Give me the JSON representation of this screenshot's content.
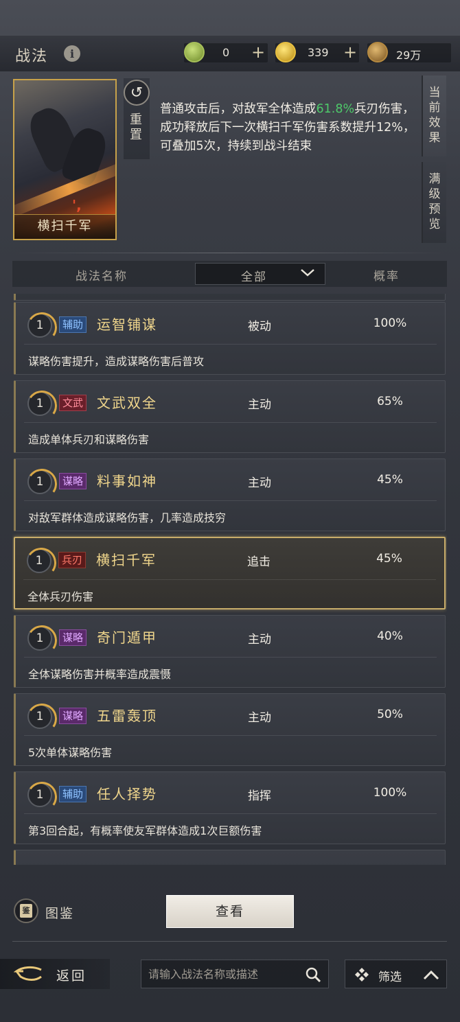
{
  "header": {
    "title": "战法",
    "info_icon": "i",
    "resources": [
      {
        "name": "jade-coin",
        "value": "0",
        "color": "#8fae4a"
      },
      {
        "name": "gold-coin",
        "value": "339",
        "color": "#d9b42a"
      },
      {
        "name": "copper-coin",
        "value": "29万",
        "color": "#a8803a"
      }
    ],
    "plus": "+"
  },
  "skill_card": {
    "name": "横扫千军",
    "mark": "',"
  },
  "reset": {
    "icon": "↺",
    "label": "重置"
  },
  "description": {
    "before": "普通攻击后，对敌军全体造成",
    "highlight": "61.8%",
    "after": "兵刃伤害，成功释放后下一次横扫千军伤害系数提升12%，可叠加5次，持续到战斗结束",
    "highlight_color": "#4ec96a"
  },
  "side_tabs": [
    {
      "label": "当前效果",
      "active": true
    },
    {
      "label": "满级预览",
      "active": false
    }
  ],
  "table_header": {
    "name_col": "战法名称",
    "filter_value": "全部",
    "rate_col": "概率"
  },
  "skills": [
    {
      "level": "1",
      "tag": "辅助",
      "tag_class": "fuzhu",
      "name": "运智铺谋",
      "type": "被动",
      "rate": "100%",
      "desc": "谋略伤害提升，造成谋略伤害后普攻",
      "selected": false
    },
    {
      "level": "1",
      "tag": "文武",
      "tag_class": "wenwu",
      "name": "文武双全",
      "type": "主动",
      "rate": "65%",
      "desc": "造成单体兵刃和谋略伤害",
      "selected": false
    },
    {
      "level": "1",
      "tag": "谋略",
      "tag_class": "moulue",
      "name": "料事如神",
      "type": "主动",
      "rate": "45%",
      "desc": "对敌军群体造成谋略伤害，几率造成技穷",
      "selected": false
    },
    {
      "level": "1",
      "tag": "兵刃",
      "tag_class": "bingren",
      "name": "横扫千军",
      "type": "追击",
      "rate": "45%",
      "desc": "全体兵刃伤害",
      "selected": true
    },
    {
      "level": "1",
      "tag": "谋略",
      "tag_class": "moulue",
      "name": "奇门遁甲",
      "type": "主动",
      "rate": "40%",
      "desc": "全体谋略伤害并概率造成震慑",
      "selected": false
    },
    {
      "level": "1",
      "tag": "谋略",
      "tag_class": "moulue",
      "name": "五雷轰顶",
      "type": "主动",
      "rate": "50%",
      "desc": "5次单体谋略伤害",
      "selected": false
    },
    {
      "level": "1",
      "tag": "辅助",
      "tag_class": "fuzhu",
      "name": "任人择势",
      "type": "指挥",
      "rate": "100%",
      "desc": "第3回合起，有概率使友军群体造成1次巨额伤害",
      "selected": false
    }
  ],
  "bottom": {
    "atlas_icon": "鉴",
    "atlas_label": "图鉴",
    "view_button": "查看",
    "back_label": "返回",
    "search_placeholder": "请输入战法名称或描述",
    "filter_label": "筛选"
  }
}
